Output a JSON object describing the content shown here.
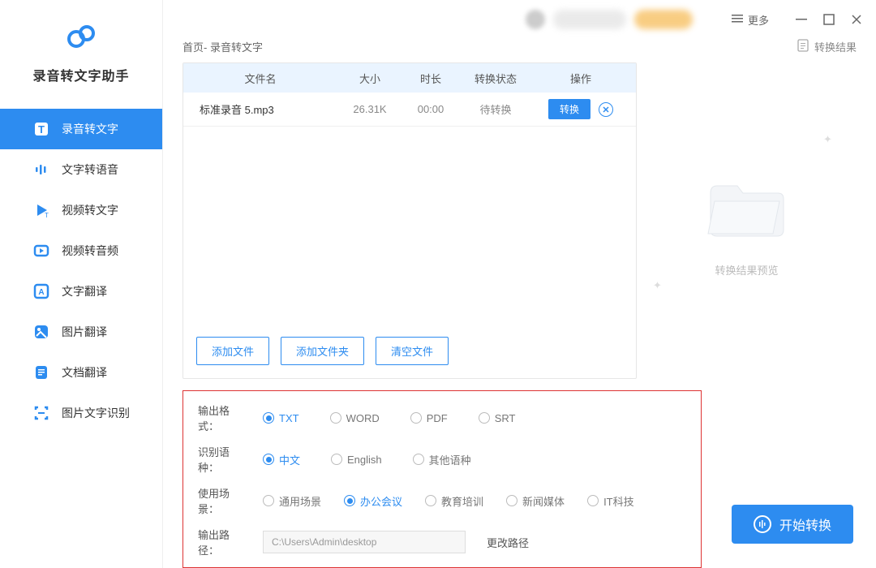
{
  "app": {
    "name": "录音转文字助手"
  },
  "titlebar": {
    "more": "更多"
  },
  "sidebar": {
    "items": [
      {
        "label": "录音转文字"
      },
      {
        "label": "文字转语音"
      },
      {
        "label": "视频转文字"
      },
      {
        "label": "视频转音频"
      },
      {
        "label": "文字翻译"
      },
      {
        "label": "图片翻译"
      },
      {
        "label": "文档翻译"
      },
      {
        "label": "图片文字识别"
      }
    ]
  },
  "breadcrumb": {
    "text": "首页- 录音转文字",
    "result_link": "转换结果"
  },
  "table": {
    "headers": {
      "name": "文件名",
      "size": "大小",
      "duration": "时长",
      "status": "转换状态",
      "action": "操作"
    },
    "rows": [
      {
        "name": "标准录音 5.mp3",
        "size": "26.31K",
        "duration": "00:00",
        "status": "待转换",
        "action": "转换"
      }
    ]
  },
  "buttons": {
    "add_file": "添加文件",
    "add_folder": "添加文件夹",
    "clear": "清空文件",
    "start": "开始转换"
  },
  "preview": {
    "placeholder": "转换结果预览"
  },
  "options": {
    "format": {
      "label": "输出格式：",
      "items": [
        "TXT",
        "WORD",
        "PDF",
        "SRT"
      ],
      "selected": 0
    },
    "language": {
      "label": "识别语种：",
      "items": [
        "中文",
        "English",
        "其他语种"
      ],
      "selected": 0
    },
    "scene": {
      "label": "使用场景：",
      "items": [
        "通用场景",
        "办公会议",
        "教育培训",
        "新闻媒体",
        "IT科技"
      ],
      "selected": 1
    },
    "path": {
      "label": "输出路径：",
      "value": "C:\\Users\\Admin\\desktop",
      "change": "更改路径"
    }
  }
}
